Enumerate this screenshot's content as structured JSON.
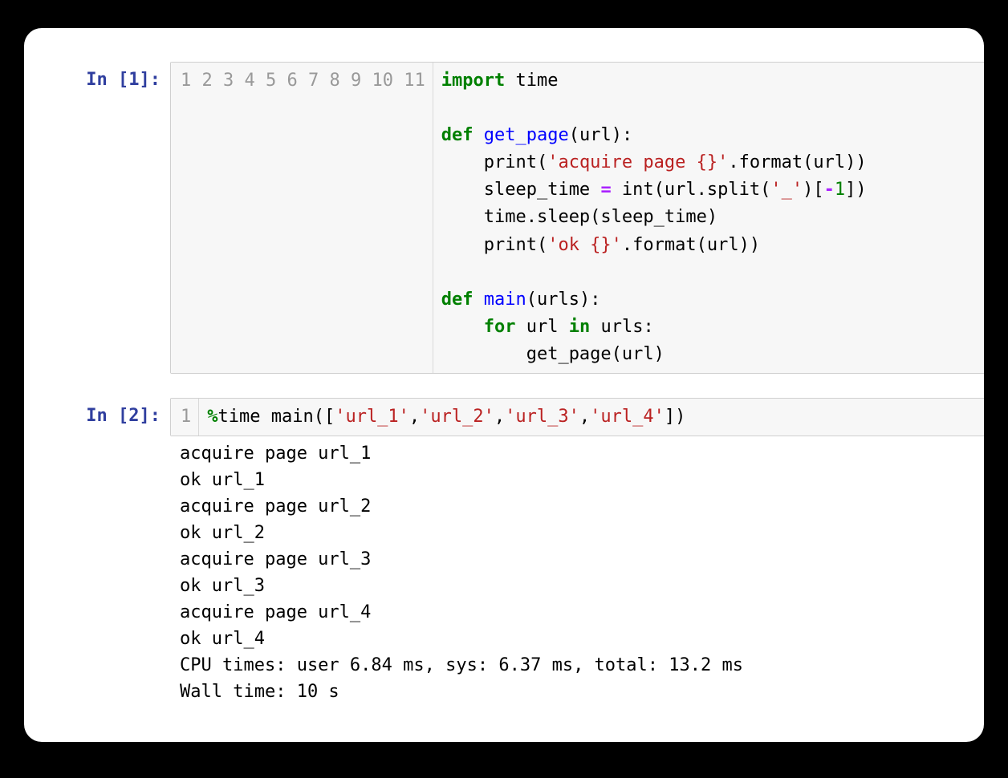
{
  "cell1": {
    "prompt_prefix": "In [",
    "prompt_num": "1",
    "prompt_suffix": "]:",
    "lines": {
      "n1": "1",
      "n2": "2",
      "n3": "3",
      "n4": "4",
      "n5": "5",
      "n6": "6",
      "n7": "7",
      "n8": "8",
      "n9": "9",
      "n10": "10",
      "n11": "11"
    },
    "code": {
      "l1_import": "import",
      "l1_rest": " time",
      "l3_def": "def",
      "l3_name": "get_page",
      "l3_paren_open": "(url):",
      "l4_indent": "    print(",
      "l4_str": "'acquire page {}'",
      "l4_rest": ".format(url))",
      "l5_indent": "    sleep_time ",
      "l5_eq": "=",
      "l5_mid": " int(url.split(",
      "l5_str": "'_'",
      "l5_br": ")[",
      "l5_neg": "-",
      "l5_one": "1",
      "l5_close": "])",
      "l6": "    time.sleep(sleep_time)",
      "l7_indent": "    print(",
      "l7_str": "'ok {}'",
      "l7_rest": ".format(url))",
      "l9_def": "def",
      "l9_name": "main",
      "l9_rest": "(urls):",
      "l10_indent": "    ",
      "l10_for": "for",
      "l10_mid": " url ",
      "l10_in": "in",
      "l10_rest": " urls:",
      "l11": "        get_page(url)"
    }
  },
  "cell2": {
    "prompt_prefix": "In [",
    "prompt_num": "2",
    "prompt_suffix": "]:",
    "line_num": "1",
    "code": {
      "pct": "%",
      "magic": "time",
      "call": " main([",
      "s1": "'url_1'",
      "c1": ",",
      "s2": "'url_2'",
      "c2": ",",
      "s3": "'url_3'",
      "c3": ",",
      "s4": "'url_4'",
      "close": "])"
    },
    "output": "acquire page url_1\nok url_1\nacquire page url_2\nok url_2\nacquire page url_3\nok url_3\nacquire page url_4\nok url_4\nCPU times: user 6.84 ms, sys: 6.37 ms, total: 13.2 ms\nWall time: 10 s"
  }
}
